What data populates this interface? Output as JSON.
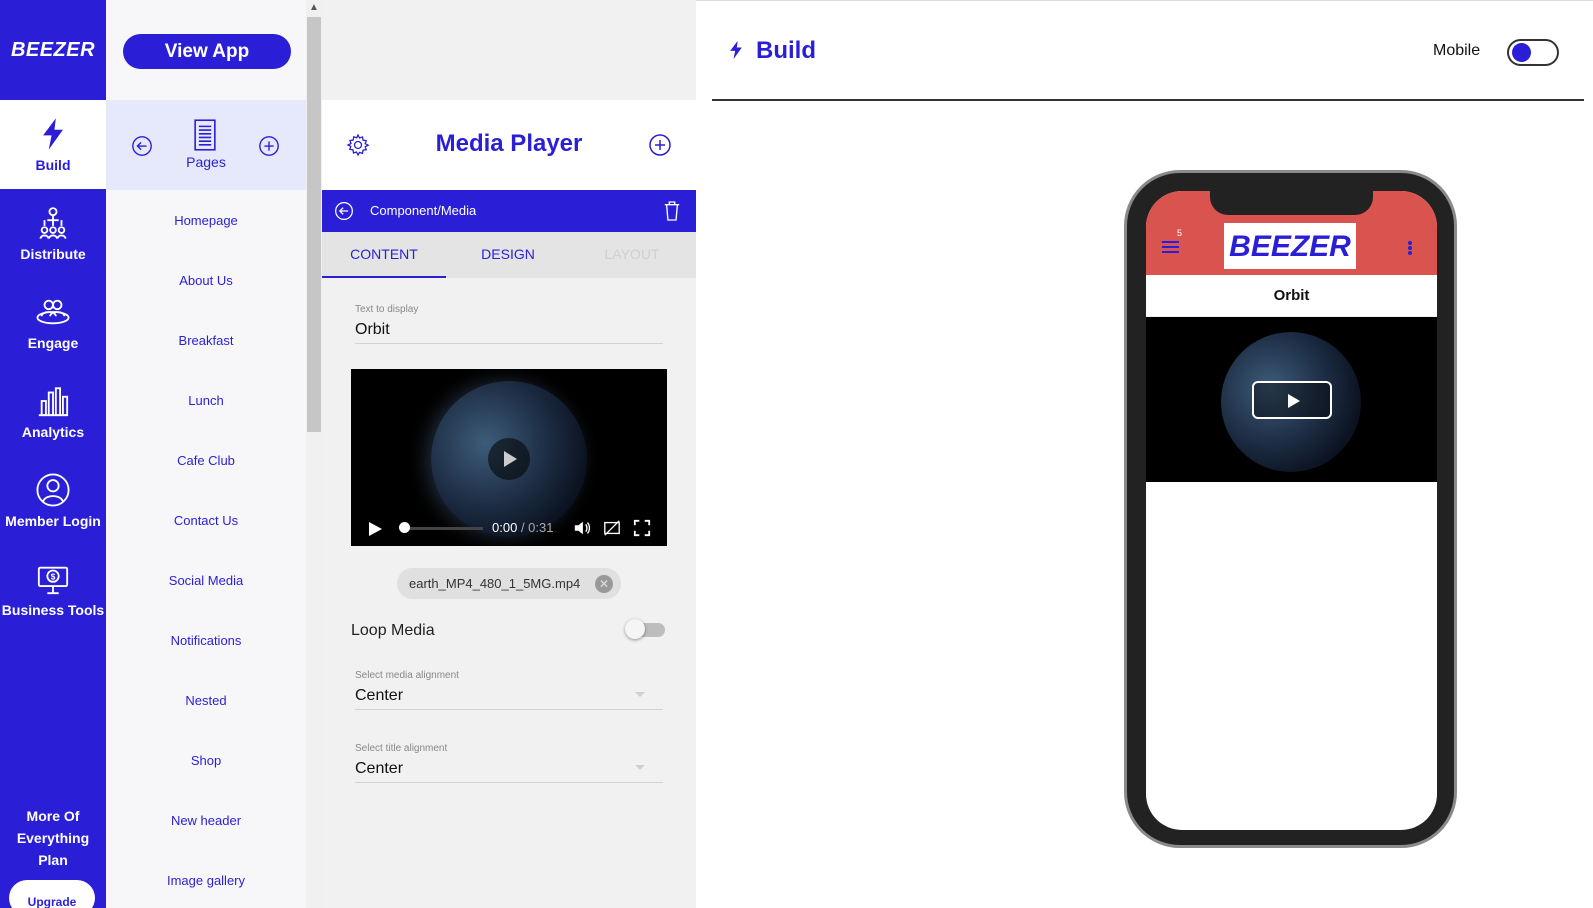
{
  "nav": {
    "logo": "BEEZER",
    "items": [
      {
        "label": "Build",
        "icon": "bolt-icon"
      },
      {
        "label": "Distribute",
        "icon": "distribute-icon"
      },
      {
        "label": "Engage",
        "icon": "engage-icon"
      },
      {
        "label": "Analytics",
        "icon": "analytics-icon"
      },
      {
        "label": "Member Login",
        "icon": "user-icon"
      },
      {
        "label": "Business Tools",
        "icon": "business-tools-icon"
      }
    ],
    "plan": [
      "More Of",
      "Everything",
      "Plan"
    ],
    "upgrade": "Upgrade"
  },
  "pages": {
    "view_app": "View App",
    "label": "Pages",
    "items": [
      "Homepage",
      "About Us",
      "Breakfast",
      "Lunch",
      "Cafe Club",
      "Contact Us",
      "Social Media",
      "Notifications",
      "Nested",
      "Shop",
      "New header",
      "Image gallery"
    ]
  },
  "editor": {
    "title": "Media Player",
    "breadcrumb": "Component/Media",
    "tabs": [
      "CONTENT",
      "DESIGN",
      "LAYOUT"
    ],
    "text_label": "Text to display",
    "text_value": "Orbit",
    "video": {
      "current": "0:00",
      "duration": "/ 0:31"
    },
    "file_chip": "earth_MP4_480_1_5MG.mp4",
    "loop_label": "Loop Media",
    "media_align_label": "Select media alignment",
    "media_align_value": "Center",
    "title_align_label": "Select title alignment",
    "title_align_value": "Center"
  },
  "preview": {
    "title": "Build",
    "mode_label": "Mobile",
    "app": {
      "logo": "BEEZER",
      "badge": "5",
      "page_title": "Orbit"
    }
  },
  "colors": {
    "brand": "#2a1fd6",
    "app_bar": "#d9534f"
  }
}
